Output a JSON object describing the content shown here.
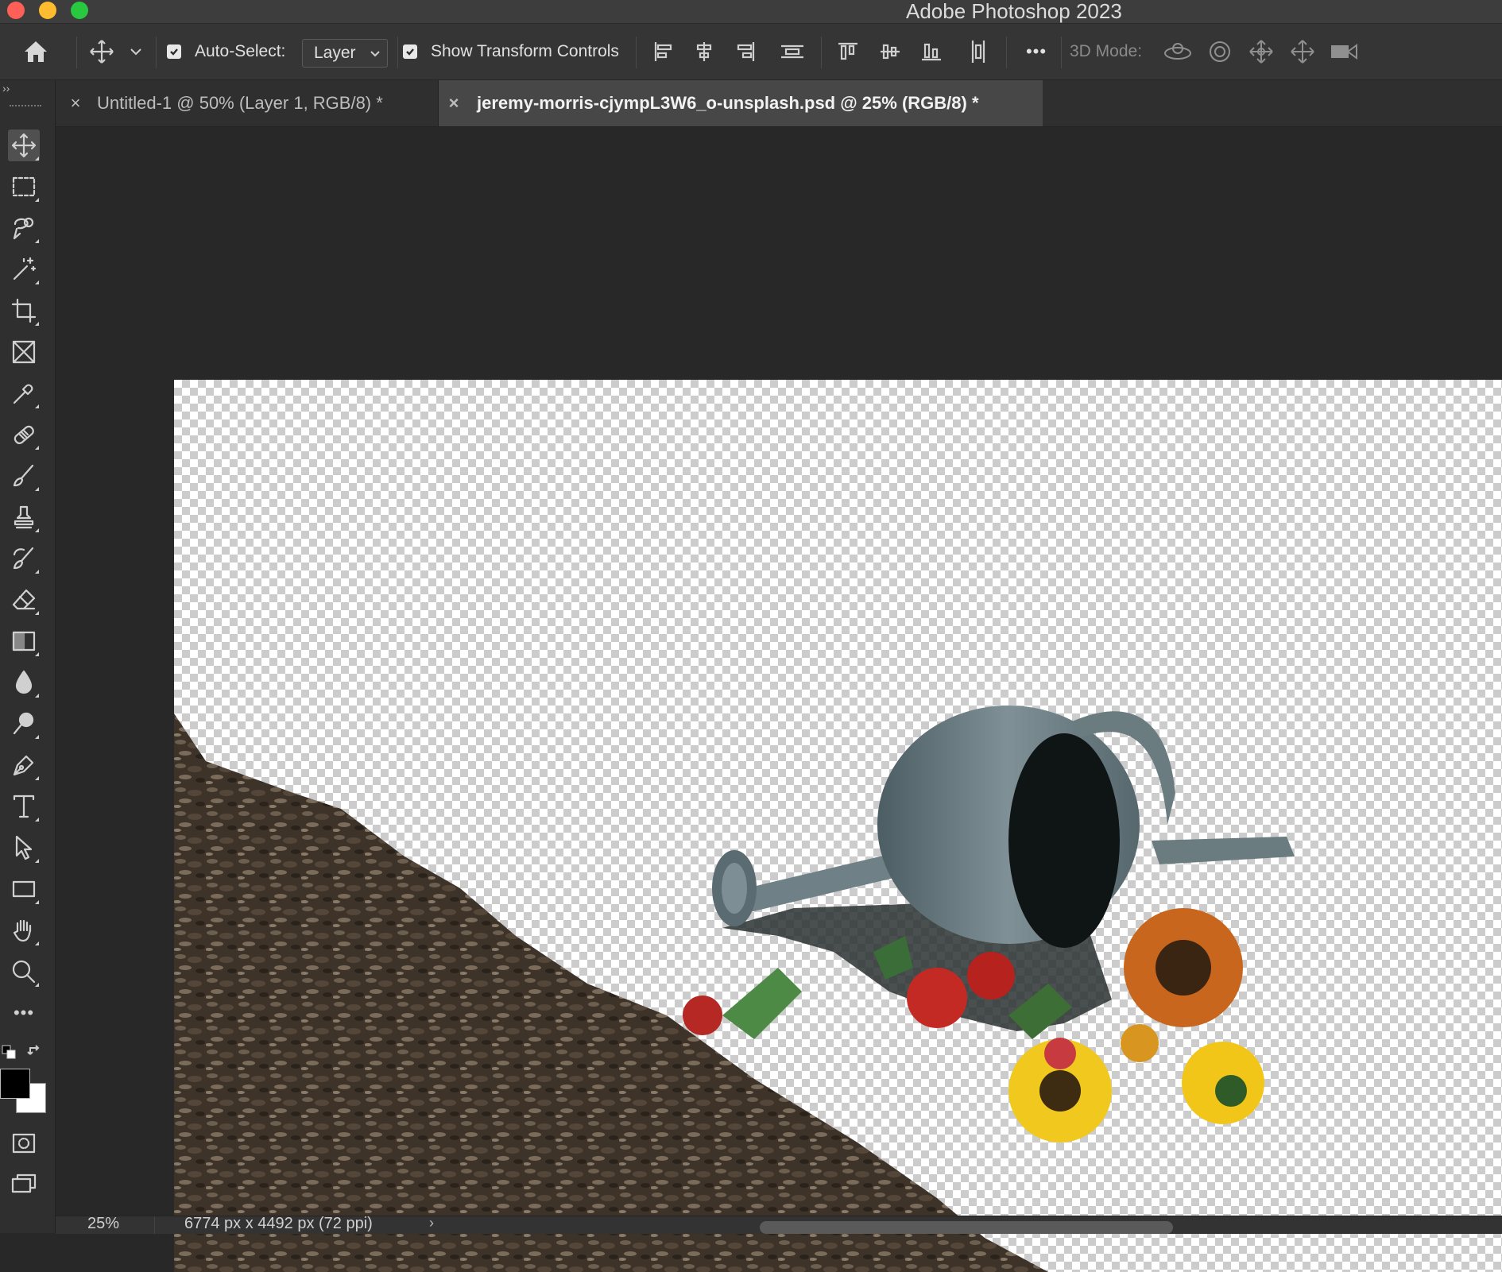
{
  "app": {
    "title": "Adobe Photoshop 2023"
  },
  "options_bar": {
    "auto_select_label": "Auto-Select:",
    "auto_select_value": "Layer",
    "show_transform_label": "Show Transform Controls",
    "more_label": "•••",
    "three_d_label": "3D Mode:"
  },
  "tabs": [
    {
      "label": "Untitled-1 @ 50% (Layer 1, RGB/8) *",
      "active": false
    },
    {
      "label": "jeremy-morris-cjympL3W6_o-unsplash.psd @ 25% (RGB/8) *",
      "active": true
    }
  ],
  "tools": [
    "move-tool",
    "rectangular-marquee-tool",
    "object-selection-tool",
    "magic-wand-tool",
    "crop-tool",
    "frame-tool",
    "eyedropper-tool",
    "spot-healing-brush-tool",
    "brush-tool",
    "clone-stamp-tool",
    "history-brush-tool",
    "eraser-tool",
    "gradient-tool",
    "blur-tool",
    "dodge-tool",
    "pen-tool",
    "type-tool",
    "path-selection-tool",
    "rectangle-tool",
    "hand-tool",
    "zoom-tool",
    "edit-toolbar"
  ],
  "toolbar": {
    "more_label": "•••"
  },
  "colors": {
    "foreground": "#000000",
    "background": "#ffffff",
    "workspace": "#282828",
    "checker": "#cccccc"
  },
  "status": {
    "zoom": "25%",
    "dimensions": "6774 px x 4492 px (72 ppi)",
    "arrow": "›"
  }
}
